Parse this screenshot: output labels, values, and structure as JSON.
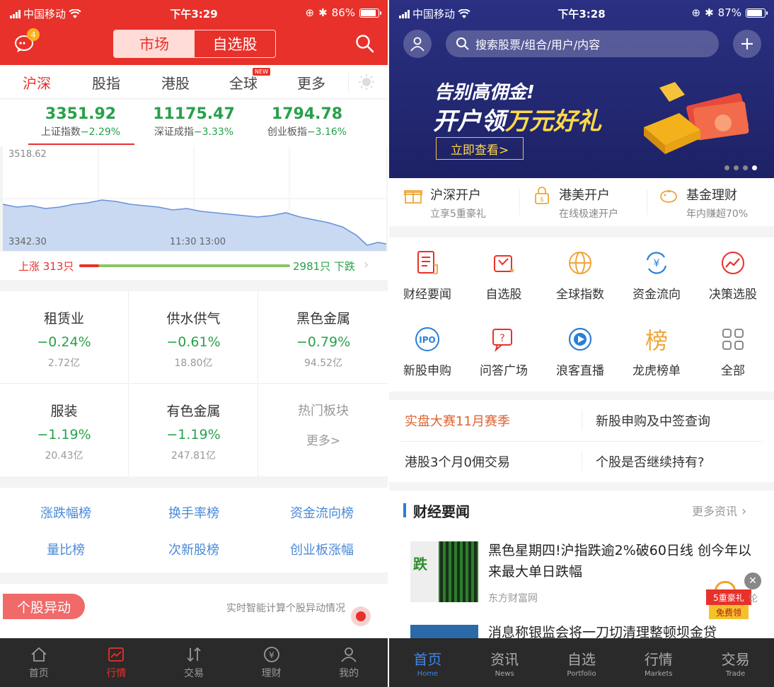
{
  "left": {
    "status": {
      "carrier": "中国移动",
      "time": "下午3:29",
      "battery": "86%",
      "battery_level": 0.86
    },
    "header": {
      "badge": "4",
      "seg_market": "市场",
      "seg_watch": "自选股"
    },
    "tabs": [
      "沪深",
      "股指",
      "港股",
      "全球",
      "更多"
    ],
    "new_badge": "NEW",
    "indices": [
      {
        "value": "3351.92",
        "name": "上证指数",
        "change": "−2.29%"
      },
      {
        "value": "11175.47",
        "name": "深证成指",
        "change": "−3.33%"
      },
      {
        "value": "1794.78",
        "name": "创业板指",
        "change": "−3.16%"
      }
    ],
    "chart": {
      "top_label": "3518.62",
      "bottom_label": "3342.30",
      "time_label": "11:30 13:00"
    },
    "updown": {
      "up": "上涨 313只",
      "down": "2981只 下跌",
      "up_ratio": 0.095
    },
    "sectors": [
      {
        "name": "租赁业",
        "pct": "−0.24%",
        "amount": "2.72亿"
      },
      {
        "name": "供水供气",
        "pct": "−0.61%",
        "amount": "18.80亿"
      },
      {
        "name": "黑色金属",
        "pct": "−0.79%",
        "amount": "94.52亿"
      },
      {
        "name": "服装",
        "pct": "−1.19%",
        "amount": "20.43亿"
      },
      {
        "name": "有色金属",
        "pct": "−1.19%",
        "amount": "247.81亿"
      }
    ],
    "hot": {
      "title": "热门板块",
      "more": "更多>"
    },
    "ranks": [
      "涨跌幅榜",
      "换手率榜",
      "资金流向榜",
      "量比榜",
      "次新股榜",
      "创业板涨幅"
    ],
    "movers": {
      "pill": "个股异动",
      "desc": "实时智能计算个股异动情况"
    },
    "nav": [
      "首页",
      "行情",
      "交易",
      "理财",
      "我的"
    ]
  },
  "right": {
    "status": {
      "carrier": "中国移动",
      "time": "下午3:28",
      "battery": "87%",
      "battery_level": 0.87
    },
    "search_placeholder": "搜索股票/组合/用户/内容",
    "banner": {
      "line1": "告别高佣金!",
      "line2a": "开户领",
      "line2b": "万元好礼",
      "cta": "立即查看>"
    },
    "open": [
      {
        "title": "沪深开户",
        "sub": "立享5重豪礼"
      },
      {
        "title": "港美开户",
        "sub": "在线极速开户"
      },
      {
        "title": "基金理财",
        "sub": "年内赚超70%"
      }
    ],
    "grid": [
      "财经要闻",
      "自选股",
      "全球指数",
      "资金流向",
      "决策选股",
      "新股申购",
      "问答广场",
      "浪客直播",
      "龙虎榜单",
      "全部"
    ],
    "grid_glyphs": {
      "ipo": "IPO",
      "rank": "榜",
      "yen": "¥"
    },
    "promos": [
      "实盘大赛11月赛季",
      "新股申购及中签查询",
      "港股3个月0佣交易",
      "个股是否继续持有?"
    ],
    "news": {
      "title": "财经要闻",
      "more": "更多资讯",
      "item1_title": "黑色星期四!沪指跌逾2%破60日线 创今年以来最大单日跌幅",
      "item1_source": "东方财富网",
      "item2_title": "消息称银监会将一刀切清理整顿坝金贷",
      "thumb_char": "跌",
      "gift_top": "5重豪礼",
      "gift_bottom": "免费领",
      "gift_peek": "论"
    },
    "nav": [
      {
        "cn": "首页",
        "en": "Home"
      },
      {
        "cn": "资讯",
        "en": "News"
      },
      {
        "cn": "自选",
        "en": "Portfolio"
      },
      {
        "cn": "行情",
        "en": "Markets"
      },
      {
        "cn": "交易",
        "en": "Trade"
      }
    ]
  }
}
